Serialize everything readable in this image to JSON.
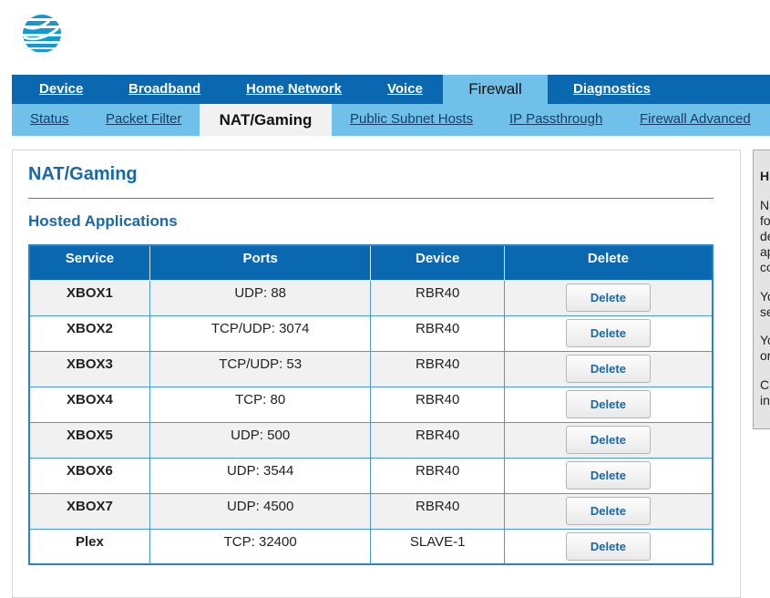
{
  "brand": {
    "accent": "#0a68b0",
    "light_accent": "#6fc1ea"
  },
  "nav_primary": {
    "items": [
      {
        "label": "Device"
      },
      {
        "label": "Broadband"
      },
      {
        "label": "Home Network"
      },
      {
        "label": "Voice"
      },
      {
        "label": "Firewall",
        "active": true
      },
      {
        "label": "Diagnostics"
      }
    ]
  },
  "nav_secondary": {
    "items": [
      {
        "label": "Status"
      },
      {
        "label": "Packet Filter"
      },
      {
        "label": "NAT/Gaming",
        "active": true
      },
      {
        "label": "Public Subnet Hosts"
      },
      {
        "label": "IP Passthrough"
      },
      {
        "label": "Firewall Advanced"
      }
    ]
  },
  "main": {
    "page_title": "NAT/Gaming",
    "section_title": "Hosted Applications",
    "table": {
      "headers": [
        "Service",
        "Ports",
        "Device",
        "Delete"
      ],
      "rows": [
        {
          "service": "XBOX1",
          "ports": "UDP: 88",
          "device": "RBR40",
          "action": "Delete"
        },
        {
          "service": "XBOX2",
          "ports": "TCP/UDP: 3074",
          "device": "RBR40",
          "action": "Delete"
        },
        {
          "service": "XBOX3",
          "ports": "TCP/UDP: 53",
          "device": "RBR40",
          "action": "Delete"
        },
        {
          "service": "XBOX4",
          "ports": "TCP: 80",
          "device": "RBR40",
          "action": "Delete"
        },
        {
          "service": "XBOX5",
          "ports": "UDP: 500",
          "device": "RBR40",
          "action": "Delete"
        },
        {
          "service": "XBOX6",
          "ports": "UDP: 3544",
          "device": "RBR40",
          "action": "Delete"
        },
        {
          "service": "XBOX7",
          "ports": "UDP: 4500",
          "device": "RBR40",
          "action": "Delete"
        },
        {
          "service": "Plex",
          "ports": "TCP: 32400",
          "device": "SLAVE-1",
          "action": "Delete"
        }
      ]
    }
  },
  "help": {
    "title": "H",
    "paragraphs": [
      [
        "N",
        "fo",
        "de",
        "ap",
        "co"
      ],
      [
        "Yo",
        "se"
      ],
      [
        "Yo",
        "or"
      ],
      [
        "C",
        "in"
      ]
    ]
  }
}
